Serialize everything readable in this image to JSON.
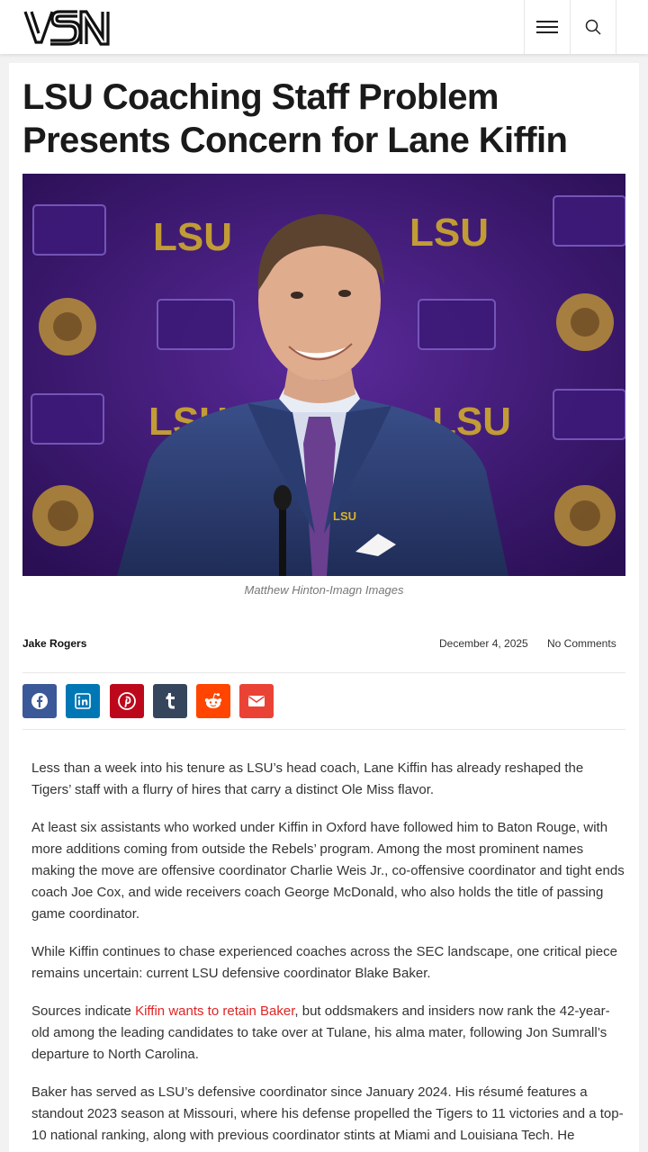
{
  "header": {
    "logo_text": "VSN",
    "menu_icon": "hamburger-menu-icon",
    "search_icon": "search-icon"
  },
  "article": {
    "title": "LSU Coaching Staff Problem Presents Concern for Lane Kiffin",
    "image_credit": "Matthew Hinton-Imagn Images",
    "image_backdrop_text": "LSU",
    "author": "Jake Rogers",
    "date": "December 4, 2025",
    "comments": "No Comments",
    "share_buttons": [
      {
        "network": "facebook",
        "icon": "facebook-icon",
        "color": "#3b5998"
      },
      {
        "network": "linkedin",
        "icon": "linkedin-icon",
        "color": "#0077b5"
      },
      {
        "network": "pinterest",
        "icon": "pinterest-icon",
        "color": "#bd081c"
      },
      {
        "network": "tumblr",
        "icon": "tumblr-icon",
        "color": "#35465c"
      },
      {
        "network": "reddit",
        "icon": "reddit-icon",
        "color": "#ff4500"
      },
      {
        "network": "email",
        "icon": "email-icon",
        "color": "#ea4335"
      }
    ],
    "paragraphs": {
      "p1": "Less than a week into his tenure as LSU’s head coach, Lane Kiffin has already reshaped the Tigers’ staff with a flurry of hires that carry a distinct Ole Miss flavor.",
      "p2": "At least six assistants who worked under Kiffin in Oxford have followed him to Baton Rouge, with more additions coming from outside the Rebels’ program. Among the most prominent names making the move are offensive coordinator Charlie Weis Jr., co-offensive coordinator and tight ends coach Joe Cox, and wide receivers coach George McDonald, who also holds the title of passing game coordinator.",
      "p3": "While Kiffin continues to chase experienced coaches across the SEC landscape, one critical piece remains uncertain: current LSU defensive coordinator Blake Baker.",
      "p4_before": "Sources indicate ",
      "p4_link": "Kiffin wants to retain Baker",
      "p4_after": ", but oddsmakers and insiders now rank the 42-year-old among the leading candidates to take over at Tulane, his alma mater, following Jon Sumrall’s departure to North Carolina.",
      "p5": "Baker has served as LSU’s defensive coordinator since January 2024. His résumé features a standout 2023 season at Missouri, where his defense propelled the Tigers to 11 victories and a top-10 national ranking, along with previous coordinator stints at Miami and Louisiana Tech. He"
    },
    "link_color": "#e02424"
  }
}
